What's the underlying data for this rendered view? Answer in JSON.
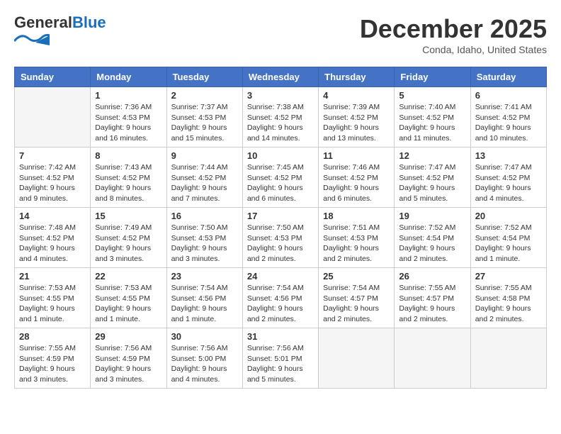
{
  "header": {
    "logo_general": "General",
    "logo_blue": "Blue",
    "month_title": "December 2025",
    "location": "Conda, Idaho, United States"
  },
  "days_of_week": [
    "Sunday",
    "Monday",
    "Tuesday",
    "Wednesday",
    "Thursday",
    "Friday",
    "Saturday"
  ],
  "weeks": [
    [
      {
        "day": "",
        "info": ""
      },
      {
        "day": "1",
        "info": "Sunrise: 7:36 AM\nSunset: 4:53 PM\nDaylight: 9 hours\nand 16 minutes."
      },
      {
        "day": "2",
        "info": "Sunrise: 7:37 AM\nSunset: 4:53 PM\nDaylight: 9 hours\nand 15 minutes."
      },
      {
        "day": "3",
        "info": "Sunrise: 7:38 AM\nSunset: 4:52 PM\nDaylight: 9 hours\nand 14 minutes."
      },
      {
        "day": "4",
        "info": "Sunrise: 7:39 AM\nSunset: 4:52 PM\nDaylight: 9 hours\nand 13 minutes."
      },
      {
        "day": "5",
        "info": "Sunrise: 7:40 AM\nSunset: 4:52 PM\nDaylight: 9 hours\nand 11 minutes."
      },
      {
        "day": "6",
        "info": "Sunrise: 7:41 AM\nSunset: 4:52 PM\nDaylight: 9 hours\nand 10 minutes."
      }
    ],
    [
      {
        "day": "7",
        "info": "Sunrise: 7:42 AM\nSunset: 4:52 PM\nDaylight: 9 hours\nand 9 minutes."
      },
      {
        "day": "8",
        "info": "Sunrise: 7:43 AM\nSunset: 4:52 PM\nDaylight: 9 hours\nand 8 minutes."
      },
      {
        "day": "9",
        "info": "Sunrise: 7:44 AM\nSunset: 4:52 PM\nDaylight: 9 hours\nand 7 minutes."
      },
      {
        "day": "10",
        "info": "Sunrise: 7:45 AM\nSunset: 4:52 PM\nDaylight: 9 hours\nand 6 minutes."
      },
      {
        "day": "11",
        "info": "Sunrise: 7:46 AM\nSunset: 4:52 PM\nDaylight: 9 hours\nand 6 minutes."
      },
      {
        "day": "12",
        "info": "Sunrise: 7:47 AM\nSunset: 4:52 PM\nDaylight: 9 hours\nand 5 minutes."
      },
      {
        "day": "13",
        "info": "Sunrise: 7:47 AM\nSunset: 4:52 PM\nDaylight: 9 hours\nand 4 minutes."
      }
    ],
    [
      {
        "day": "14",
        "info": "Sunrise: 7:48 AM\nSunset: 4:52 PM\nDaylight: 9 hours\nand 4 minutes."
      },
      {
        "day": "15",
        "info": "Sunrise: 7:49 AM\nSunset: 4:52 PM\nDaylight: 9 hours\nand 3 minutes."
      },
      {
        "day": "16",
        "info": "Sunrise: 7:50 AM\nSunset: 4:53 PM\nDaylight: 9 hours\nand 3 minutes."
      },
      {
        "day": "17",
        "info": "Sunrise: 7:50 AM\nSunset: 4:53 PM\nDaylight: 9 hours\nand 2 minutes."
      },
      {
        "day": "18",
        "info": "Sunrise: 7:51 AM\nSunset: 4:53 PM\nDaylight: 9 hours\nand 2 minutes."
      },
      {
        "day": "19",
        "info": "Sunrise: 7:52 AM\nSunset: 4:54 PM\nDaylight: 9 hours\nand 2 minutes."
      },
      {
        "day": "20",
        "info": "Sunrise: 7:52 AM\nSunset: 4:54 PM\nDaylight: 9 hours\nand 1 minute."
      }
    ],
    [
      {
        "day": "21",
        "info": "Sunrise: 7:53 AM\nSunset: 4:55 PM\nDaylight: 9 hours\nand 1 minute."
      },
      {
        "day": "22",
        "info": "Sunrise: 7:53 AM\nSunset: 4:55 PM\nDaylight: 9 hours\nand 1 minute."
      },
      {
        "day": "23",
        "info": "Sunrise: 7:54 AM\nSunset: 4:56 PM\nDaylight: 9 hours\nand 1 minute."
      },
      {
        "day": "24",
        "info": "Sunrise: 7:54 AM\nSunset: 4:56 PM\nDaylight: 9 hours\nand 2 minutes."
      },
      {
        "day": "25",
        "info": "Sunrise: 7:54 AM\nSunset: 4:57 PM\nDaylight: 9 hours\nand 2 minutes."
      },
      {
        "day": "26",
        "info": "Sunrise: 7:55 AM\nSunset: 4:57 PM\nDaylight: 9 hours\nand 2 minutes."
      },
      {
        "day": "27",
        "info": "Sunrise: 7:55 AM\nSunset: 4:58 PM\nDaylight: 9 hours\nand 2 minutes."
      }
    ],
    [
      {
        "day": "28",
        "info": "Sunrise: 7:55 AM\nSunset: 4:59 PM\nDaylight: 9 hours\nand 3 minutes."
      },
      {
        "day": "29",
        "info": "Sunrise: 7:56 AM\nSunset: 4:59 PM\nDaylight: 9 hours\nand 3 minutes."
      },
      {
        "day": "30",
        "info": "Sunrise: 7:56 AM\nSunset: 5:00 PM\nDaylight: 9 hours\nand 4 minutes."
      },
      {
        "day": "31",
        "info": "Sunrise: 7:56 AM\nSunset: 5:01 PM\nDaylight: 9 hours\nand 5 minutes."
      },
      {
        "day": "",
        "info": ""
      },
      {
        "day": "",
        "info": ""
      },
      {
        "day": "",
        "info": ""
      }
    ]
  ]
}
